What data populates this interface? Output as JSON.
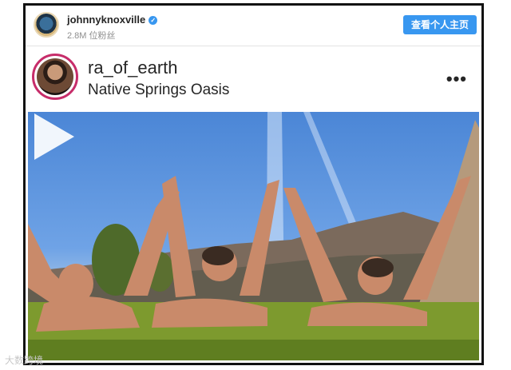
{
  "header": {
    "username": "johnnyknoxville",
    "followers": "2.8M 位粉丝",
    "profile_button": "查看个人主页"
  },
  "post": {
    "username": "ra_of_earth",
    "location": "Native Springs Oasis",
    "more": "•••"
  },
  "watermark": "大数跨境",
  "colors": {
    "accent": "#3897f0",
    "avatar_ring": "#c72d6a"
  },
  "icons": [
    "verified-icon",
    "more-options-icon",
    "play-icon"
  ]
}
